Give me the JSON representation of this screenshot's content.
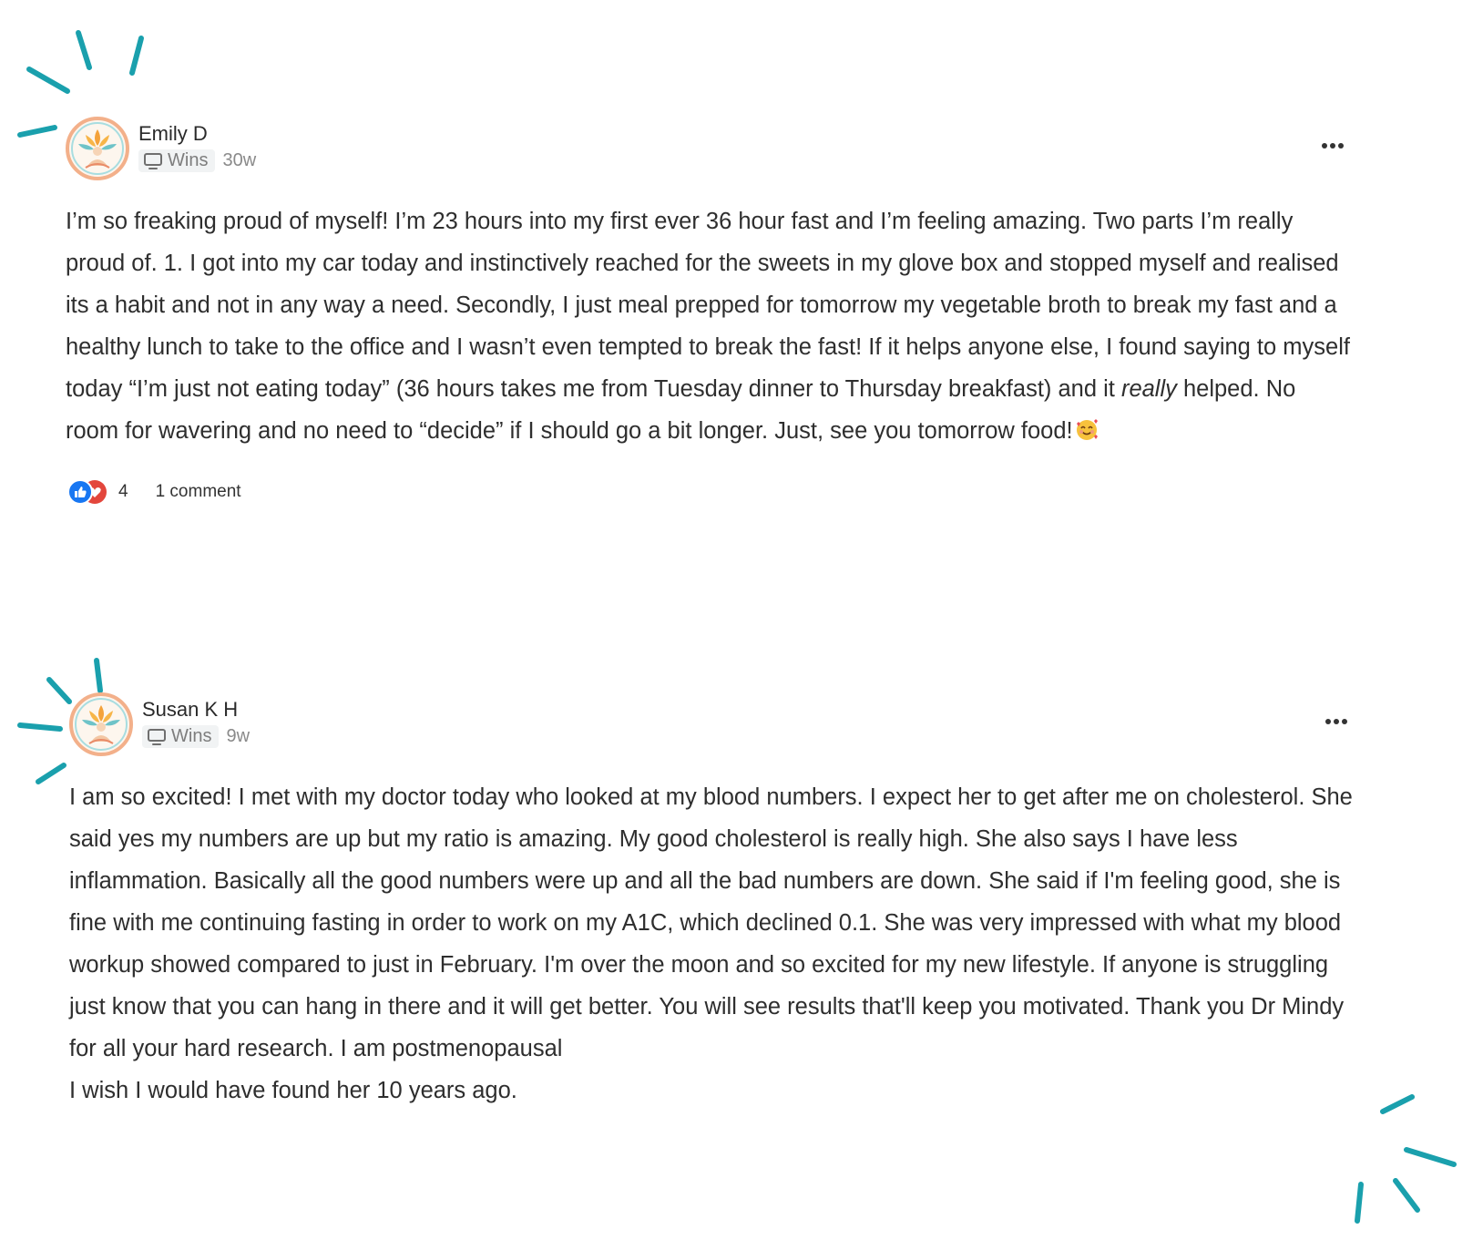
{
  "colors": {
    "accent_sparkle": "#1aa0ad",
    "like_blue": "#1877f2",
    "love_red": "#e3463c",
    "chip_bg": "#f1f3f4"
  },
  "posts": [
    {
      "author": "Emily D",
      "avatar_icon": "lotus-meditation-avatar-icon",
      "category_icon": "monitor-icon",
      "category": "Wins",
      "time_ago": "30w",
      "more_icon": "more-options-icon",
      "body_before_em": "I’m so freaking proud of myself! I’m 23 hours into my first ever 36 hour fast and I’m feeling amazing. Two parts I’m really proud of. 1. I got into my car today and instinctively reached for the sweets in my glove box and stopped myself and realised its a habit and not in any way a need. Secondly, I just meal prepped for tomorrow my vegetable broth to break my fast and a healthy lunch to take to the office and I wasn’t even tempted to break the fast! If it helps anyone else, I found saying to myself today “I’m just not eating today” (36 hours takes me from Tuesday dinner to Thursday breakfast) and it ",
      "body_em": "really",
      "body_after_em": " helped. No room for wavering and no need to “decide” if I should go a bit longer. Just, see you tomorrow food!",
      "body_emoji": "smiling-face-with-hearts-emoji",
      "reaction_icons": [
        "like-icon",
        "love-icon"
      ],
      "reaction_count": "4",
      "comments_label": "1 comment"
    },
    {
      "author": "Susan K H",
      "avatar_icon": "lotus-meditation-avatar-icon",
      "category_icon": "monitor-icon",
      "category": "Wins",
      "time_ago": "9w",
      "more_icon": "more-options-icon",
      "body_lines": [
        "I am so excited! I met with my doctor today who looked at my blood numbers. I expect her to get after me on cholesterol. She said yes my numbers are up but my ratio is amazing. My good cholesterol is really high. She also says I have less inflammation. Basically all the good numbers were up and all the bad numbers are down. She said if I'm feeling good, she is fine with me continuing fasting in order to work on my A1C, which declined 0.1. She was very impressed with what my blood workup showed compared to just in February. I'm over the moon and so excited for my new lifestyle. If anyone is struggling just know that you can hang in there and it will get better. You will see results that'll keep you motivated. Thank you Dr Mindy for all your hard research. I am postmenopausal",
        "I wish I would have found her 10 years ago."
      ]
    }
  ]
}
